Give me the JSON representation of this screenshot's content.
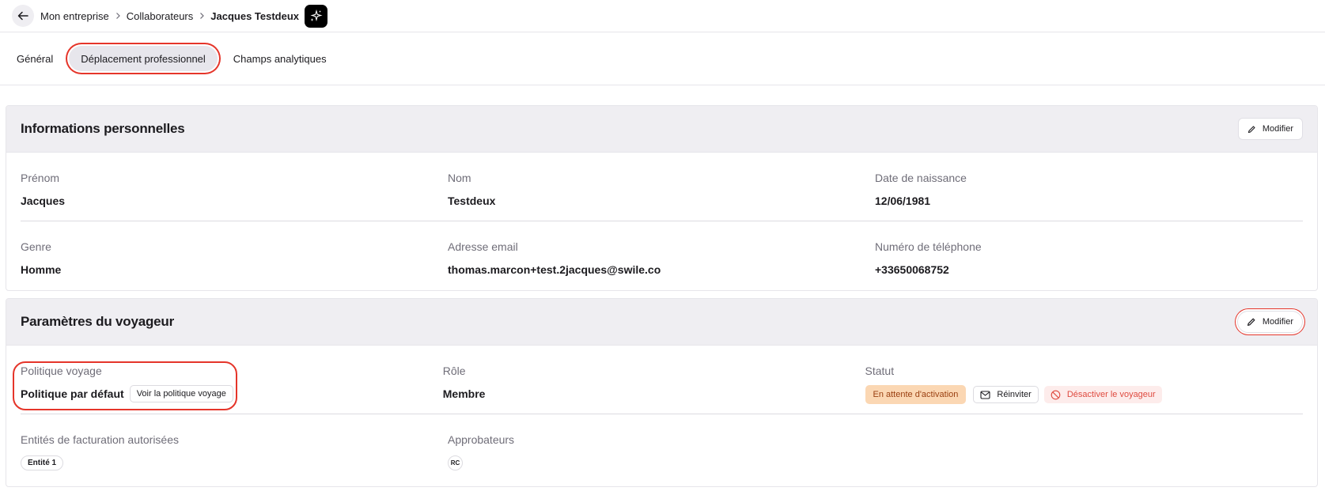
{
  "breadcrumb": {
    "items": [
      "Mon entreprise",
      "Collaborateurs",
      "Jacques Testdeux"
    ]
  },
  "tabs": [
    "Général",
    "Déplacement professionnel",
    "Champs analytiques"
  ],
  "personal": {
    "title": "Informations personnelles",
    "modify_label": "Modifier",
    "first_name": {
      "label": "Prénom",
      "value": "Jacques"
    },
    "last_name": {
      "label": "Nom",
      "value": "Testdeux"
    },
    "birth_date": {
      "label": "Date de naissance",
      "value": "12/06/1981"
    },
    "gender": {
      "label": "Genre",
      "value": "Homme"
    },
    "email": {
      "label": "Adresse email",
      "value": "thomas.marcon+test.2jacques@swile.co"
    },
    "phone": {
      "label": "Numéro de téléphone",
      "value": "+33650068752"
    }
  },
  "traveler": {
    "title": "Paramètres du voyageur",
    "modify_label": "Modifier",
    "policy": {
      "label": "Politique voyage",
      "value": "Politique par défaut",
      "button": "Voir la politique voyage"
    },
    "role": {
      "label": "Rôle",
      "value": "Membre"
    },
    "status": {
      "label": "Statut",
      "badge": "En attente d'activation",
      "reinvite": "Réinviter",
      "deactivate": "Désactiver le voyageur"
    },
    "billing": {
      "label": "Entités de facturation autorisées",
      "chip": "Entité 1"
    },
    "approvers": {
      "label": "Approbateurs",
      "avatar": "RC"
    }
  },
  "colors": {
    "accent_highlight": "#e5352a",
    "pending_bg": "#fbd7b3",
    "danger": "#df4b40"
  }
}
